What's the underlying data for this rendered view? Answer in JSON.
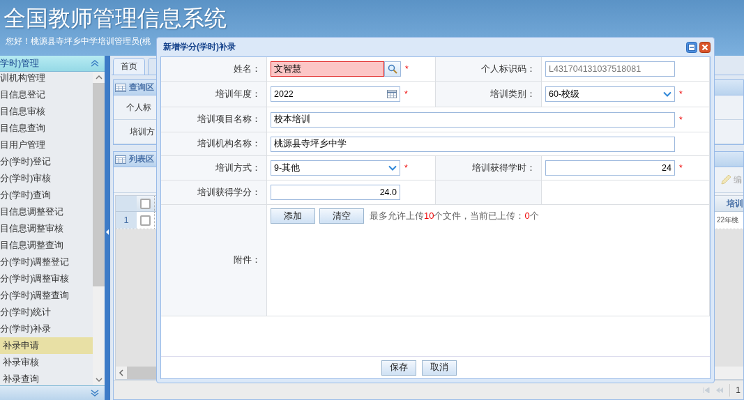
{
  "header": {
    "title": "全国教师管理信息系统",
    "greeting": "您好！桃源县寺坪乡中学培训管理员(桃"
  },
  "sidebar": {
    "title": "学时)管理",
    "items": [
      {
        "label": "训机构管理",
        "selected": false
      },
      {
        "label": "目信息登记",
        "selected": false
      },
      {
        "label": "目信息审核",
        "selected": false
      },
      {
        "label": "目信息查询",
        "selected": false
      },
      {
        "label": "目用户管理",
        "selected": false
      },
      {
        "label": "分(学时)登记",
        "selected": false
      },
      {
        "label": "分(学时)审核",
        "selected": false
      },
      {
        "label": "分(学时)查询",
        "selected": false
      },
      {
        "label": "目信息调整登记",
        "selected": false
      },
      {
        "label": "目信息调整审核",
        "selected": false
      },
      {
        "label": "目信息调整查询",
        "selected": false
      },
      {
        "label": "分(学时)调整登记",
        "selected": false
      },
      {
        "label": "分(学时)调整审核",
        "selected": false
      },
      {
        "label": "分(学时)调整查询",
        "selected": false
      },
      {
        "label": "分(学时)统计",
        "selected": false
      },
      {
        "label": "分(学时)补录",
        "selected": false,
        "children": [
          {
            "label": "补录申请",
            "selected": true
          },
          {
            "label": "补录审核",
            "selected": false
          },
          {
            "label": "补录查询",
            "selected": false
          }
        ]
      }
    ]
  },
  "tabs": [
    {
      "label": "首页",
      "selected": true
    },
    {
      "selected": false
    }
  ],
  "query_panel": {
    "title": "查询区",
    "fields": [
      {
        "label": "个人标"
      },
      {
        "label": "培训方"
      }
    ]
  },
  "list_panel": {
    "title": "列表区",
    "edit_button": {
      "label": "编",
      "disabled": true
    },
    "select_all_checked": false,
    "columns": [
      "培训"
    ],
    "rows": [
      {
        "index": "1",
        "checked": false,
        "cells": [
          "22年桃"
        ]
      }
    ],
    "pager": {
      "page": "1"
    }
  },
  "dialog": {
    "title": "新增学分(学时)补录",
    "required_mark": "*",
    "rows": [
      {
        "fields": [
          {
            "label": "姓名：",
            "value": "文智慧",
            "kind": "lookup",
            "required": true,
            "error": true
          },
          {
            "label": "个人标识码：",
            "value": "L431704131037518081",
            "kind": "text",
            "required": false,
            "disabled": true
          }
        ]
      },
      {
        "fields": [
          {
            "label": "培训年度：",
            "value": "2022",
            "kind": "date",
            "required": true
          },
          {
            "label": "培训类别：",
            "value": "60-校级",
            "kind": "select",
            "required": true
          }
        ]
      },
      {
        "fields": [
          {
            "label": "培训项目名称：",
            "value": "校本培训",
            "kind": "text",
            "required": true,
            "wide": true
          }
        ]
      },
      {
        "fields": [
          {
            "label": "培训机构名称：",
            "value": "桃源县寺坪乡中学",
            "kind": "text",
            "required": false,
            "wide": true
          }
        ]
      },
      {
        "fields": [
          {
            "label": "培训方式：",
            "value": "9-其他",
            "kind": "select",
            "required": true
          },
          {
            "label": "培训获得学时：",
            "value": "24",
            "kind": "number",
            "required": true
          }
        ]
      },
      {
        "fields": [
          {
            "label": "培训获得学分：",
            "value": "24.0",
            "kind": "number",
            "required": false
          }
        ]
      }
    ],
    "attachment": {
      "label": "附件：",
      "buttons": [
        "添加",
        "清空"
      ],
      "note": [
        {
          "text": "最多允许上传",
          "highlight": false
        },
        {
          "text": "10",
          "highlight": true
        },
        {
          "text": "个文件，当前已上传：",
          "highlight": false
        },
        {
          "text": "0",
          "highlight": true
        },
        {
          "text": "个",
          "highlight": false
        }
      ]
    },
    "buttons": [
      "保存",
      "取消"
    ]
  }
}
